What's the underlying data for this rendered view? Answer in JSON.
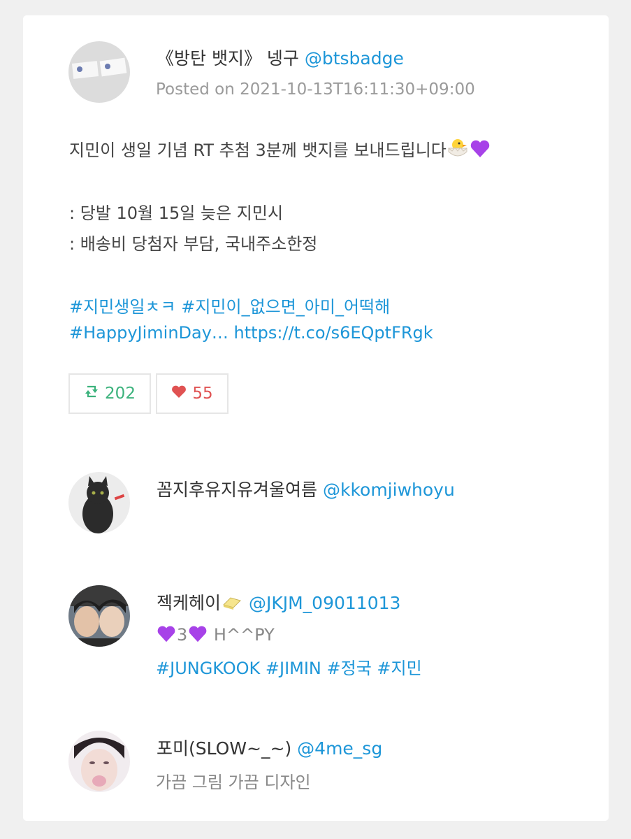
{
  "post": {
    "author_name": "《방탄 뱃지》 넹구",
    "author_handle": "@btsbadge",
    "posted": "Posted on 2021-10-13T16:11:30+09:00",
    "text_line1": "지민이 생일 기념 RT 추첨 3분께 뱃지를 보내드립니다",
    "emoji_line1": [
      "hatching-chick",
      "purple-heart"
    ],
    "detail1": ": 당발 10월 15일 늦은 지민시",
    "detail2": ": 배송비 당첨자 부담, 국내주소한정",
    "hashtags_line1": "#지민생일ㅊㅋ #지민이_없으면_아미_어떡해",
    "hashtags_line2": "#HappyJiminDay… https://t.co/s6EQptFRgk",
    "retweet_count": "202",
    "like_count": "55",
    "colors": {
      "link": "#1d96d8",
      "retweet": "#3bb27c",
      "like": "#e05252"
    }
  },
  "replies": [
    {
      "name": "꼼지후유지유겨울여름",
      "handle": "@kkomjiwhoyu"
    },
    {
      "name": "젝케헤이",
      "handle": "@JKJM_09011013",
      "bio_middle": "3",
      "bio_tail": " H^^PY",
      "bio_tags": "#JUNGKOOK #JIMIN #정국 #지민"
    },
    {
      "name": "포미(SLOW~_~)",
      "handle": "@4me_sg",
      "bio": "가끔 그림 가끔 디자인"
    }
  ]
}
